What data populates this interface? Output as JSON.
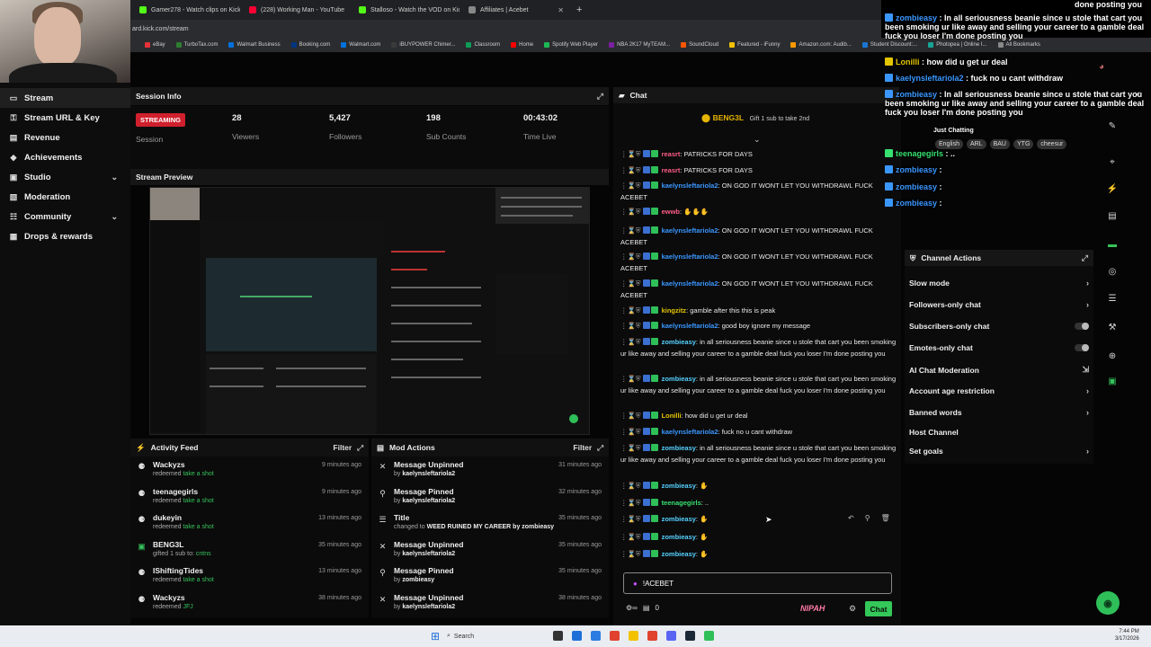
{
  "browser": {
    "tabs": [
      {
        "title": "Gamer278 - Watch clips on Kick",
        "color": "#53fc18"
      },
      {
        "title": "(228) Working Man - YouTube",
        "color": "#ff0033"
      },
      {
        "title": "Stalloso - Watch the VOD on Kick",
        "color": "#53fc18"
      },
      {
        "title": "Affiliates | Acebet",
        "color": "#888888"
      }
    ],
    "new_tab": "+",
    "url": "ard.kick.com/stream",
    "bookmarks": [
      "eBay",
      "TurboTax.com",
      "Walmart Business",
      "Booking.com",
      "Walmart.com",
      "iBUYPOWER Chimer...",
      "Classroom",
      "Home",
      "Spotify Web Player",
      "NBA 2K17 MyTEAM...",
      "SoundCloud",
      "Featured - iFunny",
      "Amazon.com: Audib...",
      "Student Discount:...",
      "Photopea | Online I...",
      "All Bookmarks"
    ]
  },
  "sidebar": {
    "items": [
      {
        "label": "Stream",
        "icon": "▭",
        "active": true
      },
      {
        "label": "Stream URL & Key",
        "icon": "⚿"
      },
      {
        "label": "Revenue",
        "icon": "▤"
      },
      {
        "label": "Achievements",
        "icon": "◆"
      },
      {
        "label": "Studio",
        "icon": "▣",
        "chevron": "⌄"
      },
      {
        "label": "Moderation",
        "icon": "▧"
      },
      {
        "label": "Community",
        "icon": "☷",
        "chevron": "⌄"
      },
      {
        "label": "Drops & rewards",
        "icon": "▦"
      }
    ]
  },
  "session": {
    "header": "Session Info",
    "badge": "STREAMING",
    "badge_label": "Session",
    "stats": [
      {
        "value": "28",
        "label": "Viewers"
      },
      {
        "value": "5,427",
        "label": "Followers"
      },
      {
        "value": "198",
        "label": "Sub Counts"
      },
      {
        "value": "00:43:02",
        "label": "Time Live"
      }
    ]
  },
  "stream_preview": {
    "header": "Stream Preview"
  },
  "activity_feed": {
    "header": "Activity Feed",
    "filter": "Filter",
    "items": [
      {
        "user": "Wackyzs",
        "action": "redeemed",
        "detail": "take a shot",
        "time": "9 minutes ago",
        "icon": "⚈"
      },
      {
        "user": "teenagegirls",
        "action": "redeemed",
        "detail": "take a shot",
        "time": "9 minutes ago",
        "icon": "⚈"
      },
      {
        "user": "dukeyin",
        "action": "redeemed",
        "detail": "take a shot",
        "time": "13 minutes ago",
        "icon": "⚈"
      },
      {
        "user": "BENG3L",
        "action": "gifted 1 sub to:",
        "detail": "cntns",
        "time": "35 minutes ago",
        "icon": "▣"
      },
      {
        "user": "IShiftingTides",
        "action": "redeemed",
        "detail": "take a shot",
        "time": "13 minutes ago",
        "icon": "⚈"
      },
      {
        "user": "Wackyzs",
        "action": "redeemed",
        "detail": "JFJ",
        "time": "38 minutes ago",
        "icon": "⚈"
      }
    ]
  },
  "mod_actions": {
    "header": "Mod Actions",
    "filter": "Filter",
    "items": [
      {
        "title": "Message Unpinned",
        "by": "by",
        "who": "kaelynsleftariola2",
        "time": "31 minutes ago",
        "icon": "✕"
      },
      {
        "title": "Message Pinned",
        "by": "by",
        "who": "kaelynsleftariola2",
        "time": "32 minutes ago",
        "icon": "⚲"
      },
      {
        "title": "Title",
        "by": "changed to",
        "who": "WEED RUINED MY CAREER",
        "extra": "by zombieasy",
        "time": "35 minutes ago",
        "icon": "☰"
      },
      {
        "title": "Message Unpinned",
        "by": "by",
        "who": "kaelynsleftariola2",
        "time": "35 minutes ago",
        "icon": "✕"
      },
      {
        "title": "Message Pinned",
        "by": "by",
        "who": "zombieasy",
        "time": "35 minutes ago",
        "icon": "⚲"
      },
      {
        "title": "Message Unpinned",
        "by": "by",
        "who": "kaelynsleftariola2",
        "time": "38 minutes ago",
        "icon": "✕"
      }
    ]
  },
  "chat": {
    "header": "Chat",
    "pinned_user": "BENG3L",
    "pinned_text": "Gift 1 sub to take 2nd",
    "messages": [
      {
        "user": "reasrt",
        "color": "c-pink",
        "text": "PATRICKS FOR DAYS"
      },
      {
        "user": "reasrt",
        "color": "c-pink",
        "text": "PATRICKS FOR DAYS"
      },
      {
        "user": "kaelynsleftariola2",
        "color": "c-blue",
        "text": "ON GOD IT WONT LET YOU WITHDRAWL FUCK ACEBET"
      },
      {
        "user": "ewwb",
        "color": "c-pink",
        "text": "✋✋✋"
      },
      {
        "user": "kaelynsleftariola2",
        "color": "c-blue",
        "text": "ON GOD IT WONT LET YOU WITHDRAWL FUCK ACEBET"
      },
      {
        "user": "kaelynsleftariola2",
        "color": "c-blue",
        "text": "ON GOD IT WONT LET YOU WITHDRAWL FUCK ACEBET"
      },
      {
        "user": "kaelynsleftariola2",
        "color": "c-blue",
        "text": "ON GOD IT WONT LET YOU WITHDRAWL FUCK ACEBET"
      },
      {
        "user": "kingzitz",
        "color": "c-yel",
        "text": "gamble after this this is peak"
      },
      {
        "user": "kaelynsleftariola2",
        "color": "c-blue",
        "text": "good boy ignore my message"
      },
      {
        "user": "zombieasy",
        "color": "c-cyan",
        "text": "in all seriousness beanie since u stole that cart you been smoking ur like away and selling your career to a gamble deal fuck you loser I'm done posting you"
      },
      {
        "user": "zombieasy",
        "color": "c-cyan",
        "text": "in all seriousness beanie since u stole that cart you been smoking ur like away and selling your career to a gamble deal fuck you loser I'm done posting you"
      },
      {
        "user": "Lonilli",
        "color": "c-yel",
        "text": "how did u get ur deal"
      },
      {
        "user": "kaelynsleftariola2",
        "color": "c-blue",
        "text": "fuck no u cant withdraw"
      },
      {
        "user": "zombieasy",
        "color": "c-cyan",
        "text": "in all seriousness beanie since u stole that cart you been smoking ur like away and selling your career to a gamble deal fuck you loser I'm done posting you"
      },
      {
        "user": "zombieasy",
        "color": "c-cyan",
        "text": "✋"
      },
      {
        "user": "teenagegirls",
        "color": "c-grn",
        "text": ".."
      },
      {
        "user": "zombieasy",
        "color": "c-cyan",
        "text": "✋"
      },
      {
        "user": "zombieasy",
        "color": "c-cyan",
        "text": "✋"
      },
      {
        "user": "zombieasy",
        "color": "c-cyan",
        "text": "✋"
      }
    ],
    "input_value": "!ACEBET",
    "send_label": "Chat",
    "footer_points": "0",
    "emote_label": "NIPAH"
  },
  "overlay": {
    "lines": [
      {
        "user": "zombieasy",
        "text": "In all seriousness beanie since u stole that cart you been smoking ur like away and selling your career to a gamble deal fuck you loser I'm done posting you"
      },
      {
        "user": "Lonilli",
        "text": "how did u get ur deal"
      },
      {
        "user": "kaelynsleftariola2",
        "text": "fuck no u cant withdraw"
      },
      {
        "user": "zombieasy",
        "text": "In all seriousness beanie since u stole that cart you been smoking ur like away and selling your career to a gamble deal fuck you loser I'm done posting you"
      },
      {
        "user": "zombieasy",
        "text": ""
      },
      {
        "user": "teenagegirls",
        "text": ".."
      },
      {
        "user": "zombieasy",
        "text": ""
      },
      {
        "user": "zombieasy",
        "text": ""
      },
      {
        "user": "zombieasy",
        "text": ""
      }
    ],
    "top_text": "done posting you",
    "stream_title": "Just Chatting",
    "tags": [
      "English",
      "ARL",
      "BAU",
      "YTG",
      "cheesur"
    ]
  },
  "channel_actions": {
    "header": "Channel Actions",
    "items": [
      {
        "label": "Slow mode",
        "type": "chevron"
      },
      {
        "label": "Followers-only chat",
        "type": "chevron"
      },
      {
        "label": "Subscribers-only chat",
        "type": "toggle"
      },
      {
        "label": "Emotes-only chat",
        "type": "toggle"
      },
      {
        "label": "AI Chat Moderation",
        "type": "link"
      },
      {
        "label": "Account age restriction",
        "type": "chevron"
      },
      {
        "label": "Banned words",
        "type": "chevron"
      },
      {
        "label": "Host Channel",
        "type": "none"
      },
      {
        "label": "Set goals",
        "type": "chevron"
      }
    ]
  },
  "taskbar": {
    "search": "Search",
    "time": "7:44 PM",
    "date": "3/17/2026"
  }
}
